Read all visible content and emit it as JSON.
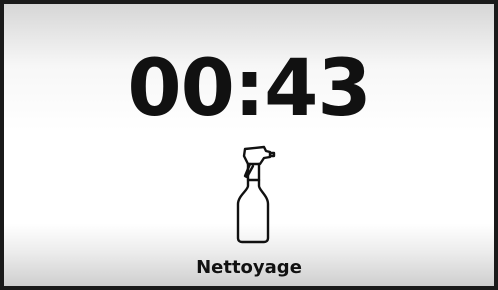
{
  "screen": {
    "timer_text": "00:43",
    "mode_label": "Nettoyage",
    "mode_icon": "spray-bottle-icon"
  },
  "colors": {
    "text": "#111111",
    "frame": "#1a1a1a"
  }
}
